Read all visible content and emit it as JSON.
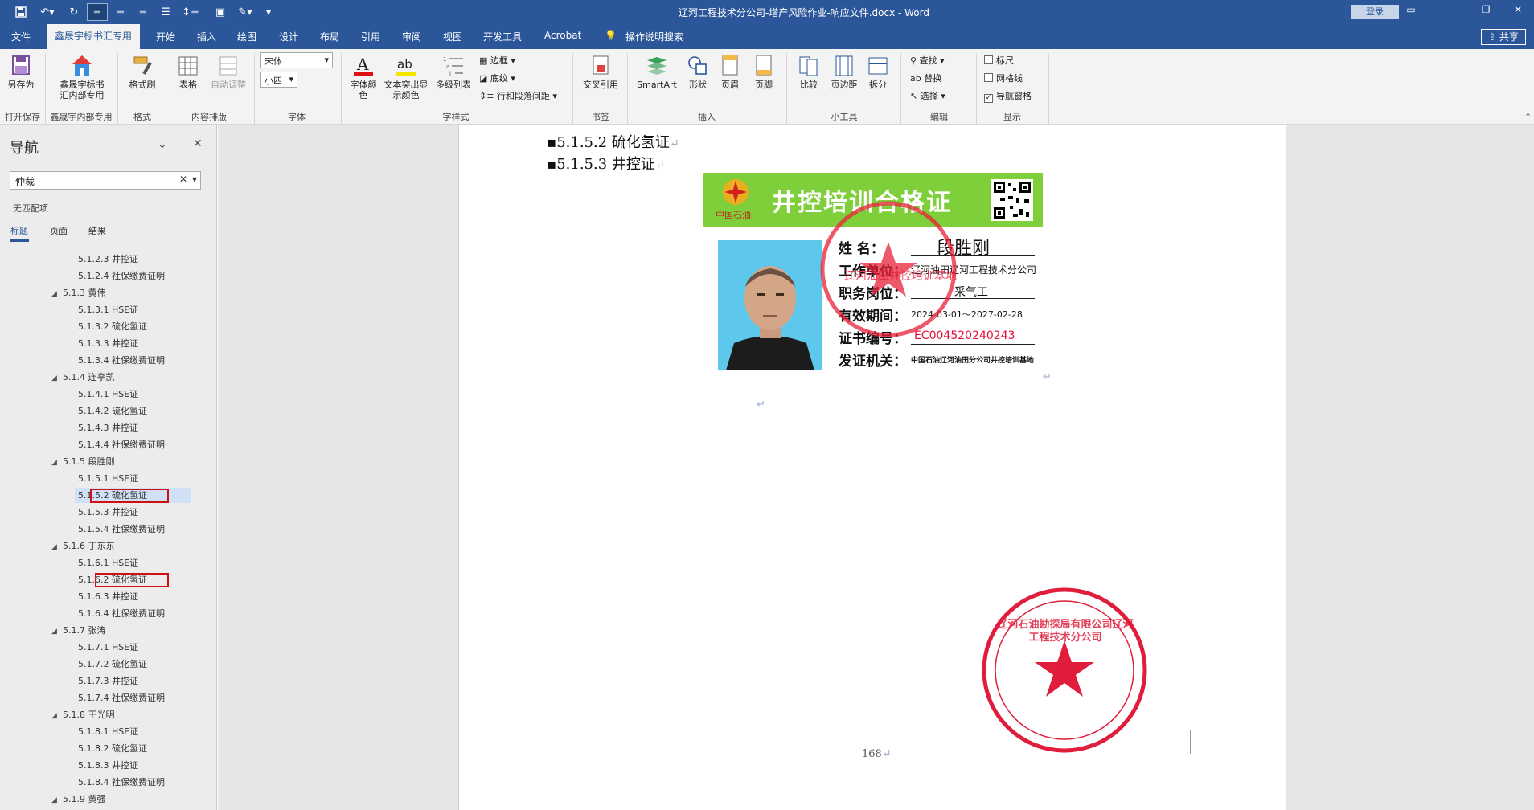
{
  "window": {
    "title": "辽河工程技术分公司-增产风险作业-响应文件.docx  -  Word",
    "login_label": "登录"
  },
  "tabs": {
    "file": "文件",
    "active": "鑫晟宇标书汇专用",
    "items": [
      "开始",
      "插入",
      "绘图",
      "设计",
      "布局",
      "引用",
      "审阅",
      "视图",
      "开发工具",
      "Acrobat"
    ],
    "tell_me": "操作说明搜索",
    "share": "共享"
  },
  "ribbon": {
    "save_as": "另存为",
    "group_open_save": "打开保存",
    "xsy_line1": "鑫晟宇标书",
    "xsy_line2": "汇内部专用",
    "group_xsy": "鑫晟宇内部专用",
    "format_painter": "格式刷",
    "group_format": "格式",
    "table": "表格",
    "auto_adjust": "自动调整",
    "group_layout": "内容排版",
    "font_name": "宋体",
    "font_size": "小四",
    "group_font": "字体",
    "font_color_line1": "字体颜",
    "font_color_line2": "色",
    "highlight_line1": "文本突出显",
    "highlight_line2": "示颜色",
    "multilevel": "多级列表",
    "border": "边框",
    "shading": "底纹",
    "line_spacing": "行和段落间距",
    "group_style": "字样式",
    "crossref": "交叉引用",
    "group_bookmark": "书签",
    "smartart": "SmartArt",
    "shapes": "形状",
    "header": "页眉",
    "footer": "页脚",
    "group_insert": "插入",
    "compare": "比较",
    "margins": "页边距",
    "split": "拆分",
    "group_tools": "小工具",
    "find": "查找",
    "replace": "替换",
    "select": "选择",
    "group_edit": "编辑",
    "ruler": "标尺",
    "gridlines": "网格线",
    "nav_pane": "导航窗格",
    "group_show": "显示"
  },
  "nav": {
    "title": "导航",
    "search_value": "仲裁",
    "no_match": "无匹配项",
    "tabs": [
      "标题",
      "页面",
      "结果"
    ],
    "items": [
      {
        "level": 3,
        "text": "5.1.2.3 井控证"
      },
      {
        "level": 3,
        "text": "5.1.2.4 社保缴费证明"
      },
      {
        "level": 2,
        "text": "5.1.3 黄伟"
      },
      {
        "level": 3,
        "text": "5.1.3.1 HSE证"
      },
      {
        "level": 3,
        "text": "5.1.3.2 硫化氢证"
      },
      {
        "level": 3,
        "text": "5.1.3.3 井控证"
      },
      {
        "level": 3,
        "text": "5.1.3.4 社保缴费证明"
      },
      {
        "level": 2,
        "text": "5.1.4 连亭凯"
      },
      {
        "level": 3,
        "text": "5.1.4.1 HSE证"
      },
      {
        "level": 3,
        "text": "5.1.4.2 硫化氢证"
      },
      {
        "level": 3,
        "text": "5.1.4.3 井控证"
      },
      {
        "level": 3,
        "text": "5.1.4.4 社保缴费证明"
      },
      {
        "level": 2,
        "text": "5.1.5 段胜刚"
      },
      {
        "level": 3,
        "text": "5.1.5.1 HSE证"
      },
      {
        "level": 3,
        "text": "5.1.5.2 硫化氢证"
      },
      {
        "level": 3,
        "text": "5.1.5.3 井控证"
      },
      {
        "level": 3,
        "text": "5.1.5.4 社保缴费证明"
      },
      {
        "level": 2,
        "text": "5.1.6 丁东东"
      },
      {
        "level": 3,
        "text": "5.1.6.1 HSE证"
      },
      {
        "level": 3,
        "text": "5.1.6.2 硫化氢证"
      },
      {
        "level": 3,
        "text": "5.1.6.3 井控证"
      },
      {
        "level": 3,
        "text": "5.1.6.4 社保缴费证明"
      },
      {
        "level": 2,
        "text": "5.1.7 张涛"
      },
      {
        "level": 3,
        "text": "5.1.7.1 HSE证"
      },
      {
        "level": 3,
        "text": "5.1.7.2 硫化氢证"
      },
      {
        "level": 3,
        "text": "5.1.7.3 井控证"
      },
      {
        "level": 3,
        "text": "5.1.7.4 社保缴费证明"
      },
      {
        "level": 2,
        "text": "5.1.8 王光明"
      },
      {
        "level": 3,
        "text": "5.1.8.1 HSE证"
      },
      {
        "level": 3,
        "text": "5.1.8.2 硫化氢证"
      },
      {
        "level": 3,
        "text": "5.1.8.3 井控证"
      },
      {
        "level": 3,
        "text": "5.1.8.4 社保缴费证明"
      },
      {
        "level": 2,
        "text": "5.1.9 黄强"
      }
    ]
  },
  "document": {
    "heading1": "5.1.5.2  硫化氢证",
    "heading2": "5.1.5.3  井控证",
    "page_number": "168",
    "certificate": {
      "title": "井控培训合格证",
      "company_logo": "中国石油",
      "name_label": "姓      名：",
      "name_value": "段胜刚",
      "unit_label": "工作单位：",
      "unit_value": "辽河油田辽河工程技术分公司",
      "post_label": "职务岗位：",
      "post_value": "采气工",
      "validity_label": "有效期间：",
      "validity_value": "2024-03-01～2027-02-28",
      "cert_no_label": "证书编号：",
      "cert_no_value": "EC004520240243",
      "issuer_label": "发证机关：",
      "issuer_value": "中国石油辽河油田分公司井控培训基地",
      "stamp_text": "辽河油田井控培训基地"
    },
    "company_stamp": "辽河石油勘探局有限公司辽河工程技术分公司"
  }
}
